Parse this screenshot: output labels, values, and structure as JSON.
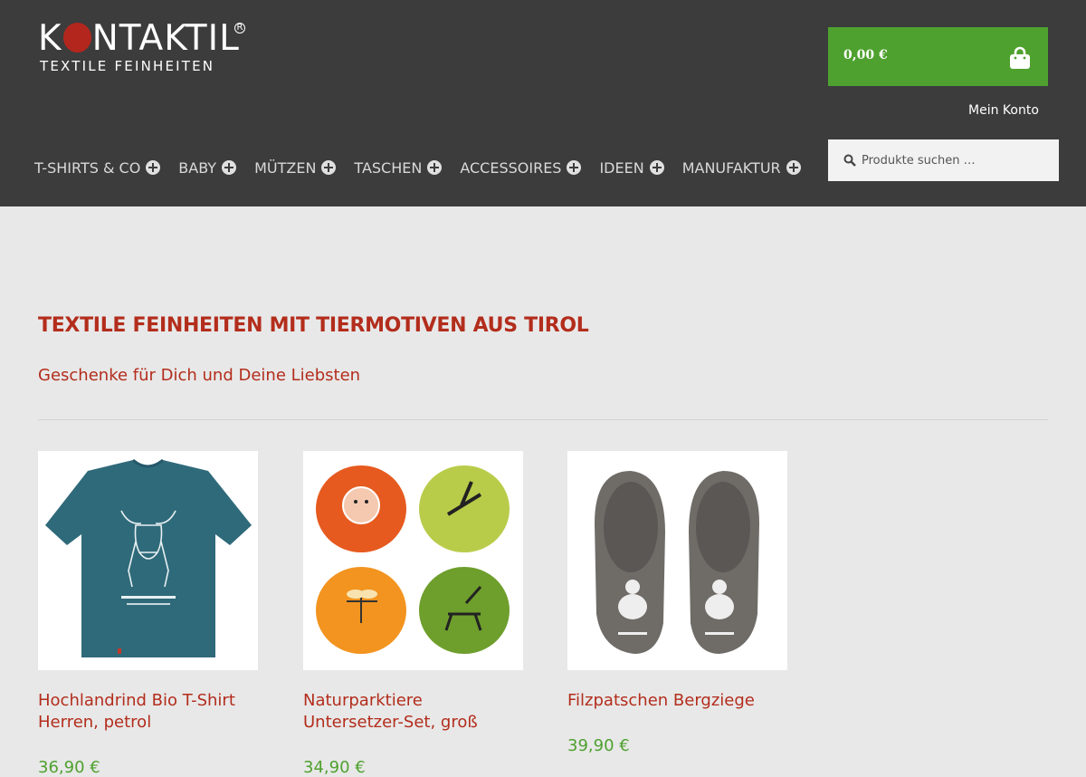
{
  "header": {
    "logo_word_1": "K",
    "logo_word_2": "NTAKTIL",
    "logo_reg": "R",
    "logo_tagline": "TEXTILE FEINHEITEN",
    "cart_amount": "0,00 €",
    "account_label": "Mein Konto",
    "search_placeholder": "Produkte suchen …"
  },
  "nav": {
    "items": [
      {
        "label": "T-SHIRTS & CO"
      },
      {
        "label": "BABY"
      },
      {
        "label": "MÜTZEN"
      },
      {
        "label": "TASCHEN"
      },
      {
        "label": "ACCESSOIRES"
      },
      {
        "label": "IDEEN"
      },
      {
        "label": "MANUFAKTUR"
      }
    ]
  },
  "main": {
    "headline": "TEXTILE FEINHEITEN MIT TIERMOTIVEN AUS TIROL",
    "subline": "Geschenke für Dich und Deine Liebsten"
  },
  "products": [
    {
      "title": "Hochlandrind Bio T-Shirt Herren, petrol",
      "price": "36,90 €",
      "image_icon": "tshirt-petrol"
    },
    {
      "title": "Naturparktiere Untersetzer-Set, groß",
      "price": "34,90 €",
      "image_icon": "coaster-set"
    },
    {
      "title": "Filzpatschen Bergziege",
      "price": "39,90 €",
      "image_icon": "felt-slippers"
    }
  ],
  "colors": {
    "header_bg": "#3c3c3c",
    "accent_red": "#b32d1c",
    "accent_green": "#4fa12f",
    "page_bg": "#e8e8e8"
  }
}
